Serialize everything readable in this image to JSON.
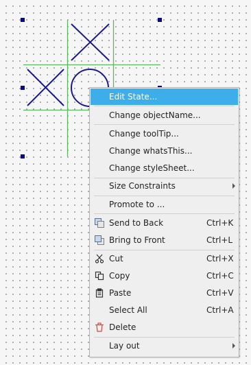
{
  "canvas": {
    "widget_icons": [
      "x-mark-icon",
      "x-mark-icon",
      "o-ring-icon"
    ]
  },
  "menu": {
    "items": [
      {
        "label": "Edit State...",
        "highlighted": true
      },
      {
        "label": "Change objectName..."
      },
      {
        "label": "Change toolTip..."
      },
      {
        "label": "Change whatsThis..."
      },
      {
        "label": "Change styleSheet..."
      },
      {
        "label": "Size Constraints",
        "submenu": true
      },
      {
        "label": "Promote to ..."
      },
      {
        "label": "Send to Back",
        "shortcut": "Ctrl+K",
        "icon": "send-to-back-icon"
      },
      {
        "label": "Bring to Front",
        "shortcut": "Ctrl+L",
        "icon": "bring-to-front-icon"
      },
      {
        "label": "Cut",
        "shortcut": "Ctrl+X",
        "icon": "scissors-icon"
      },
      {
        "label": "Copy",
        "shortcut": "Ctrl+C",
        "icon": "copy-icon"
      },
      {
        "label": "Paste",
        "shortcut": "Ctrl+V",
        "icon": "clipboard-icon"
      },
      {
        "label": "Select All",
        "shortcut": "Ctrl+A"
      },
      {
        "label": "Delete",
        "icon": "trash-icon"
      },
      {
        "label": "Lay out",
        "submenu": true
      }
    ]
  },
  "colors": {
    "highlight": "#3daee9",
    "grid_line": "#5cb85c",
    "glyph": "#1a1a8c",
    "handle": "#0b0b80",
    "delete_icon": "#d9453d"
  }
}
